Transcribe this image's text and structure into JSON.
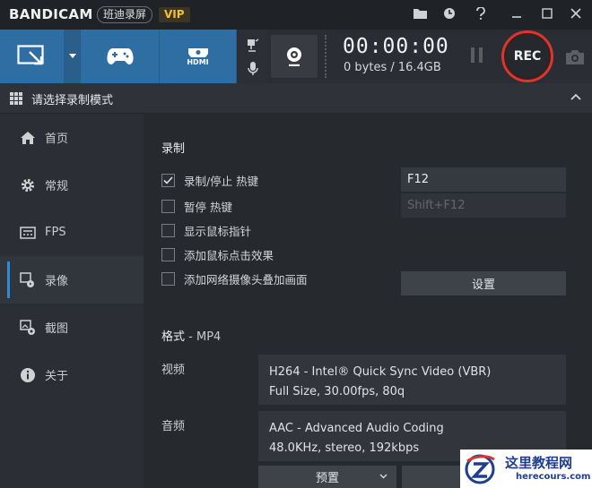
{
  "app": {
    "logo": "BANDICAM",
    "brand_cn": "班迪录屏",
    "vip": "VIP"
  },
  "toolbar": {
    "hdmi_label": "HDMI",
    "timer": "00:00:00",
    "size": "0 bytes / 16.4GB",
    "rec_label": "REC"
  },
  "mode": {
    "title": "请选择录制模式"
  },
  "sidebar": {
    "items": [
      {
        "label": "首页",
        "icon": "home-icon"
      },
      {
        "label": "常规",
        "icon": "gear-icon"
      },
      {
        "label": "FPS",
        "icon": "fps-icon"
      },
      {
        "label": "录像",
        "icon": "video-icon",
        "active": true
      },
      {
        "label": "截图",
        "icon": "image-icon"
      },
      {
        "label": "关于",
        "icon": "info-icon"
      }
    ]
  },
  "record": {
    "title": "录制",
    "options": [
      {
        "label": "录制/停止 热键",
        "checked": true
      },
      {
        "label": "暂停 热键",
        "checked": false
      },
      {
        "label": "显示鼠标指针",
        "checked": false
      },
      {
        "label": "添加鼠标点击效果",
        "checked": false
      },
      {
        "label": "添加网络摄像头叠加画面",
        "checked": false
      }
    ],
    "hotkey_record": "F12",
    "hotkey_pause": "Shift+F12",
    "settings_button": "设置"
  },
  "format": {
    "title": "格式",
    "container": " - MP4",
    "video_label": "视频",
    "video_line1": "H264 - Intel® Quick Sync Video (VBR)",
    "video_line2": "Full Size, 30.00fps, 80q",
    "audio_label": "音频",
    "audio_line1": "AAC - Advanced Audio Coding",
    "audio_line2": "48.0KHz, stereo, 192kbps",
    "preset_button": "预置"
  },
  "watermark": {
    "title": "这里教程网",
    "url": "herecours.com"
  },
  "colors": {
    "accent_blue": "#2f6ea3",
    "rec_red": "#d9362d",
    "vip_gold": "#f5c132"
  }
}
